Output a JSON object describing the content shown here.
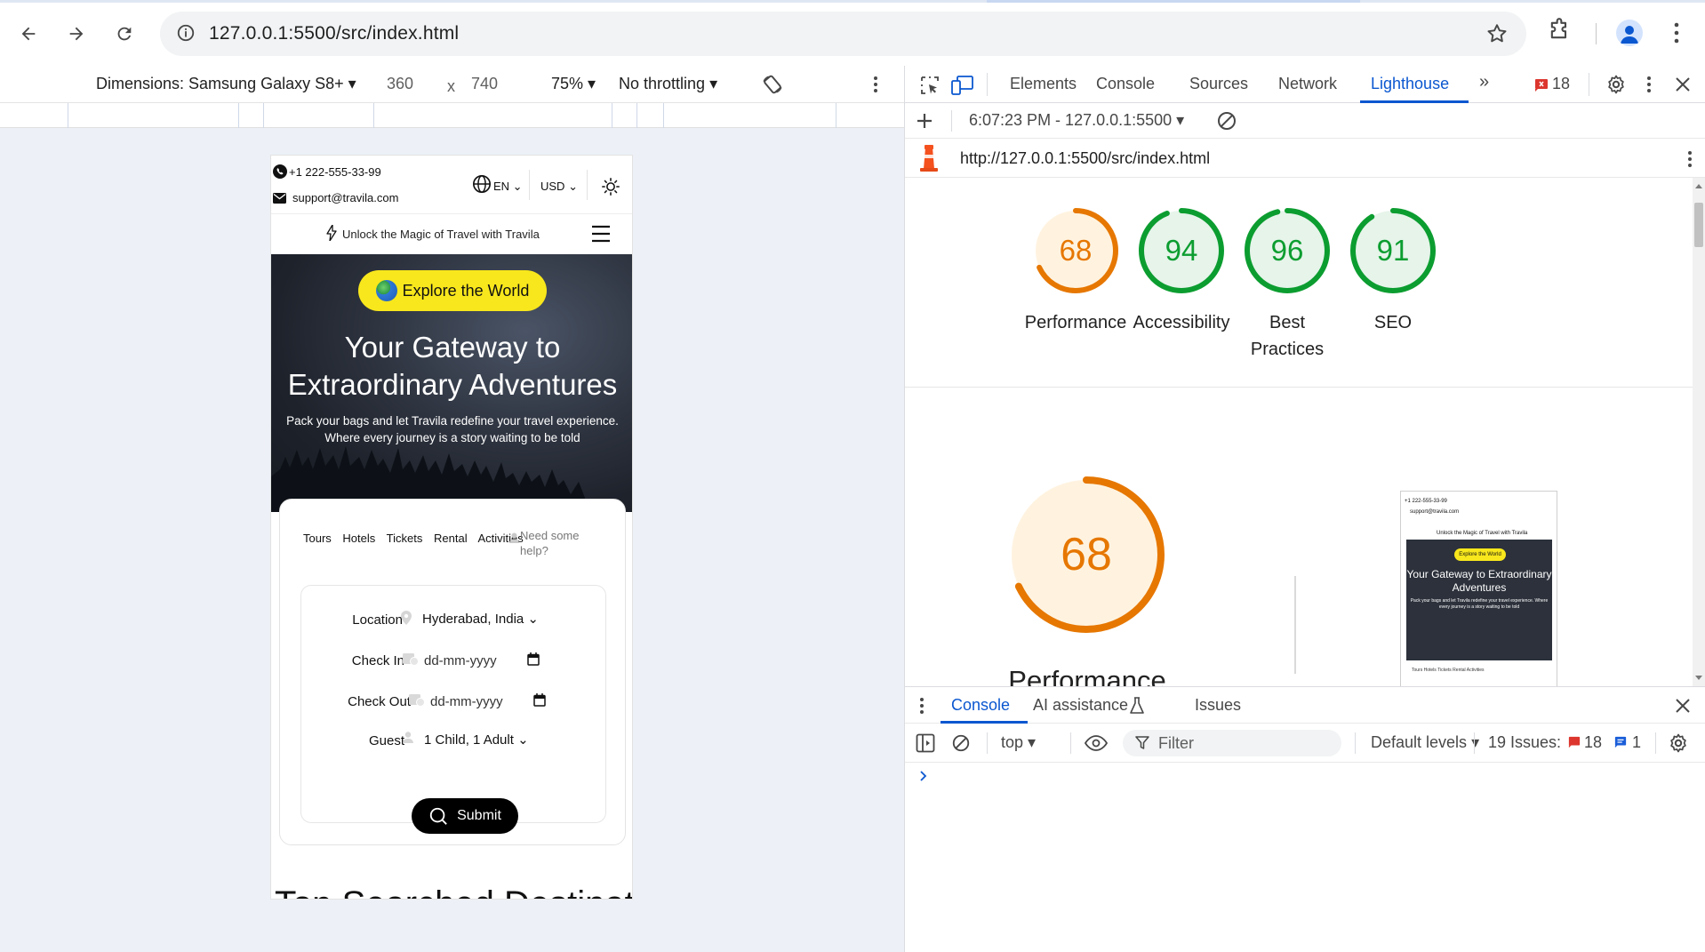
{
  "browser": {
    "url": "127.0.0.1:5500/src/index.html"
  },
  "device_toolbar": {
    "dimensions_label": "Dimensions: Samsung Galaxy S8+",
    "width": "360",
    "times": "x",
    "height": "740",
    "zoom": "75%",
    "throttling": "No throttling"
  },
  "site": {
    "phone": "+1 222-555-33-99",
    "email": "support@travila.com",
    "language": "EN",
    "currency": "USD",
    "tagline": "Unlock the Magic of Travel with Travila",
    "explore_label": "Explore the World",
    "hero_title_line1": "Your Gateway to",
    "hero_title_line2": "Extraordinary Adventures",
    "hero_sub_line1": "Pack your bags and let Travila redefine your travel experience.",
    "hero_sub_line2": "Where every journey is a story waiting to be told",
    "tabs": [
      "Tours",
      "Hotels",
      "Tickets",
      "Rental",
      "Activities"
    ],
    "help_line1": "Need some",
    "help_line2": "help?",
    "form": {
      "location_label": "Location",
      "location_value": "Hyderabad, India",
      "checkin_label": "Check In",
      "checkin_placeholder": "dd-mm-yyyy",
      "checkout_label": "Check Out",
      "checkout_placeholder": "dd-mm-yyyy",
      "guest_label": "Guest",
      "guest_value": "1 Child, 1 Adult",
      "submit_label": "Submit"
    },
    "next_section_partial": "Top Searched Destinations"
  },
  "devtools": {
    "tabs": [
      "Elements",
      "Console",
      "Sources",
      "Network",
      "Lighthouse"
    ],
    "active_tab": "Lighthouse",
    "error_count": "18",
    "lighthouse": {
      "run_label": "6:07:23 PM - 127.0.0.1:5500",
      "report_url": "http://127.0.0.1:5500/src/index.html",
      "scores": [
        {
          "name": "Performance",
          "value": 68,
          "color": "#e67700"
        },
        {
          "name": "Accessibility",
          "value": 94,
          "color": "#0c9d30"
        },
        {
          "name": "Best Practices",
          "value": 96,
          "color": "#0c9d30"
        },
        {
          "name": "SEO",
          "value": 91,
          "color": "#0c9d30"
        }
      ],
      "big_score": "68",
      "big_label": "Performance"
    },
    "drawer": {
      "tabs": [
        "Console",
        "AI assistance",
        "Issues"
      ],
      "context": "top",
      "filter_placeholder": "Filter",
      "levels": "Default levels",
      "issues_label": "19 Issues:",
      "issues_errors": "18",
      "issues_info": "1"
    }
  }
}
